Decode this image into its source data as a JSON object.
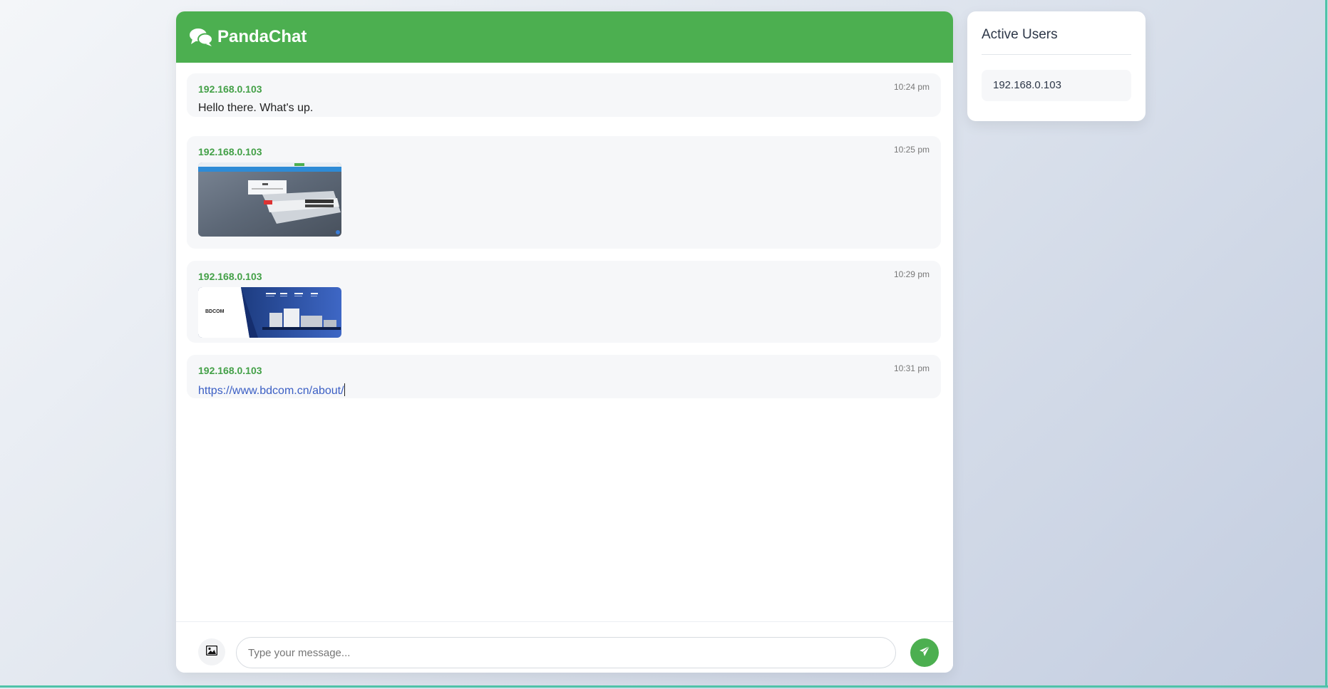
{
  "app": {
    "title": "PandaChat",
    "icon": "comments-icon"
  },
  "messages": [
    {
      "user": "192.168.0.103",
      "time": "10:24 pm",
      "type": "text",
      "text": "Hello there. What's up."
    },
    {
      "user": "192.168.0.103",
      "time": "10:25 pm",
      "type": "image",
      "image": "network-switch-webpage-screenshot"
    },
    {
      "user": "192.168.0.103",
      "time": "10:29 pm",
      "type": "image",
      "image": "bdcom-banner-screenshot",
      "logo_text": "BDCOM"
    },
    {
      "user": "192.168.0.103",
      "time": "10:31 pm",
      "type": "link",
      "text": "https://www.bdcom.cn/about/"
    }
  ],
  "composer": {
    "placeholder": "Type your message...",
    "image_button_icon": "image-icon",
    "send_button_icon": "paper-plane-icon"
  },
  "sidebar": {
    "title": "Active Users",
    "users": [
      "192.168.0.103"
    ]
  },
  "colors": {
    "brand": "#4caf50",
    "username": "#43a047",
    "link": "#3b5fc4",
    "accent_line": "#4fc3a8"
  }
}
